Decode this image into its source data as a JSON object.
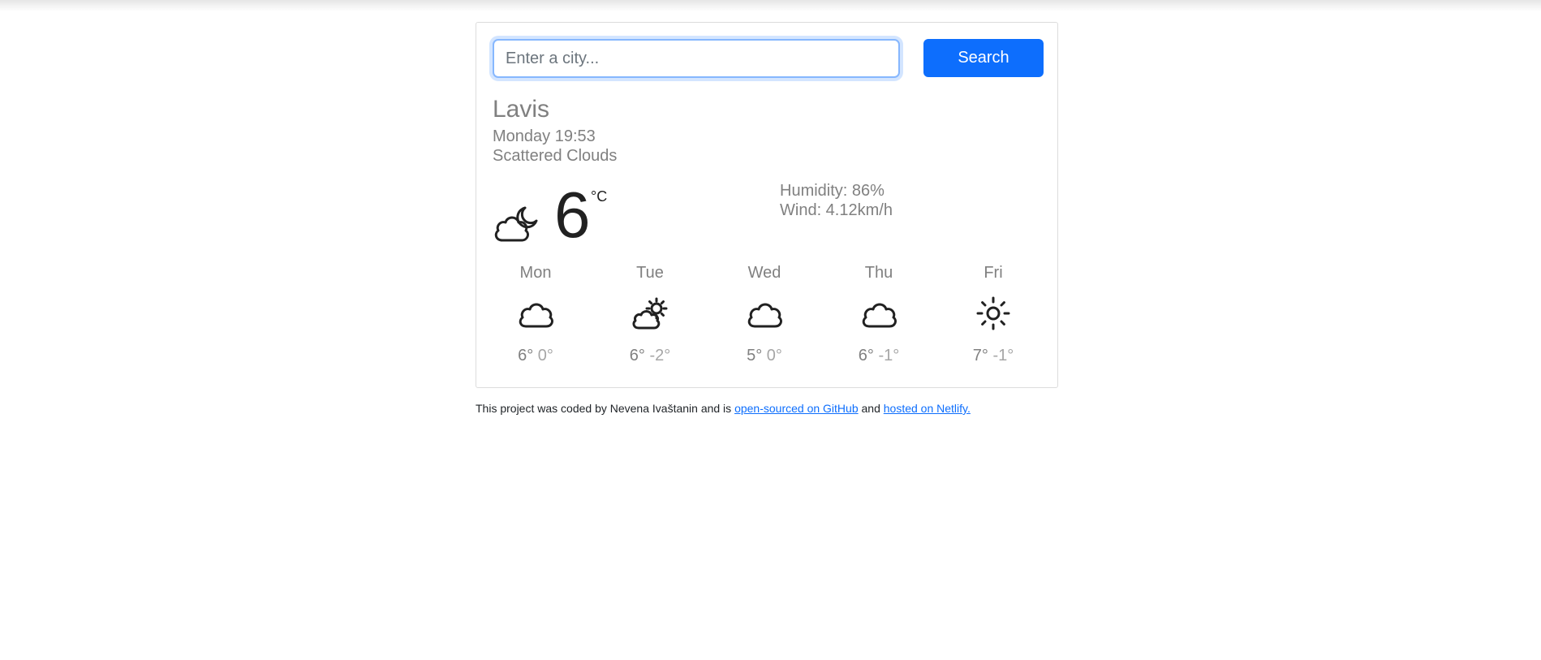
{
  "search": {
    "placeholder": "Enter a city...",
    "value": "",
    "button_label": "Search"
  },
  "current": {
    "city": "Lavis",
    "datetime": "Monday 19:53",
    "description": "Scattered Clouds",
    "icon": "cloud-moon-icon",
    "temperature": "6",
    "unit": "°C",
    "humidity": "Humidity: 86%",
    "wind": "Wind: 4.12km/h"
  },
  "forecast": [
    {
      "day": "Mon",
      "icon": "cloud-icon",
      "max": "6°",
      "min": "0°"
    },
    {
      "day": "Tue",
      "icon": "cloud-sun-icon",
      "max": "6°",
      "min": "-2°"
    },
    {
      "day": "Wed",
      "icon": "cloud-icon",
      "max": "5°",
      "min": "0°"
    },
    {
      "day": "Thu",
      "icon": "cloud-icon",
      "max": "6°",
      "min": "-1°"
    },
    {
      "day": "Fri",
      "icon": "sun-icon",
      "max": "7°",
      "min": "-1°"
    }
  ],
  "footer": {
    "text_prefix": "This project was coded by Nevena Ivaštanin and is",
    "github_link": "open-sourced on GitHub",
    "text_middle": "and",
    "netlify_link": "hosted on Netlify."
  },
  "colors": {
    "accent": "#0d6efd",
    "muted_text": "#808080",
    "light_text": "#a6a6a6"
  }
}
